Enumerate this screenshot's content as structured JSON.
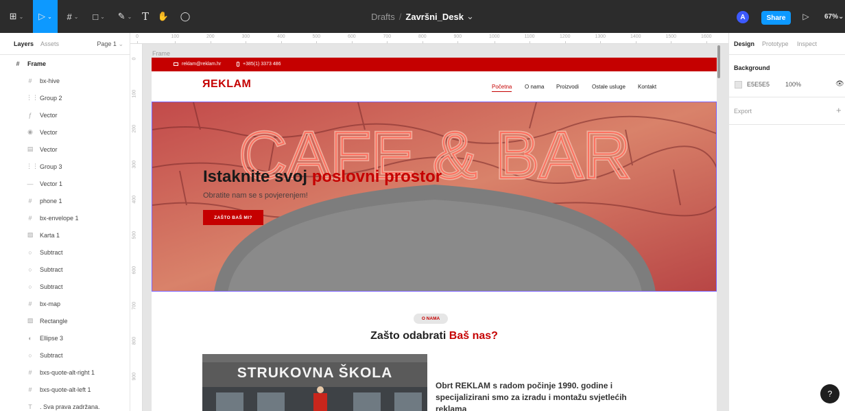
{
  "toolbar": {
    "main_menu_icon": "figma-menu-icon",
    "tools": [
      {
        "name": "move-tool",
        "glyph": "▷"
      },
      {
        "name": "frame-tool",
        "glyph": "#"
      },
      {
        "name": "shape-tool",
        "glyph": "□"
      },
      {
        "name": "pen-tool",
        "glyph": "✎"
      },
      {
        "name": "text-tool",
        "glyph": "T"
      },
      {
        "name": "hand-tool",
        "glyph": "✋"
      },
      {
        "name": "comment-tool",
        "glyph": "◯"
      }
    ],
    "breadcrumb_drafts": "Drafts",
    "breadcrumb_sep": "/",
    "file_name": "Završni_Desk",
    "avatar_initial": "A",
    "share_label": "Share",
    "zoom_label": "67%",
    "accent_color": "#0d99ff"
  },
  "left_panel": {
    "tabs": [
      "Layers",
      "Assets"
    ],
    "page_selector": "Page 1",
    "layers": [
      {
        "icon": "#",
        "label": "Frame",
        "top": true
      },
      {
        "icon": "#",
        "label": "bx-hive"
      },
      {
        "icon": "⋮⋮",
        "label": "Group 2"
      },
      {
        "icon": "ƒ",
        "label": "Vector"
      },
      {
        "icon": "◉",
        "label": "Vector"
      },
      {
        "icon": "▤",
        "label": "Vector"
      },
      {
        "icon": "⋮⋮",
        "label": "Group 3"
      },
      {
        "icon": "—",
        "label": "Vector 1"
      },
      {
        "icon": "#",
        "label": "phone 1"
      },
      {
        "icon": "#",
        "label": "bx-envelope 1"
      },
      {
        "icon": "▨",
        "label": "Karta 1"
      },
      {
        "icon": "○",
        "label": "Subtract"
      },
      {
        "icon": "○",
        "label": "Subtract"
      },
      {
        "icon": "○",
        "label": "Subtract"
      },
      {
        "icon": "#",
        "label": "bx-map"
      },
      {
        "icon": "▨",
        "label": "Rectangle"
      },
      {
        "icon": "◐",
        "label": "Ellipse 3"
      },
      {
        "icon": "○",
        "label": "Subtract"
      },
      {
        "icon": "#",
        "label": "bxs-quote-alt-right 1"
      },
      {
        "icon": "#",
        "label": "bxs-quote-alt-left 1"
      },
      {
        "icon": "T",
        "label": ". Sva prava zadržana."
      }
    ]
  },
  "rulers": {
    "top": [
      "0",
      "100",
      "200",
      "300",
      "400",
      "500",
      "600",
      "700",
      "800",
      "900",
      "1000",
      "1100",
      "1200",
      "1300",
      "1400",
      "1500",
      "1600"
    ],
    "left": [
      "0",
      "100",
      "200",
      "300",
      "400",
      "500",
      "600",
      "700",
      "800",
      "900"
    ]
  },
  "canvas": {
    "frame_label": "Frame",
    "design": {
      "email": "reklam@reklam.hr",
      "phone": "+385(1) 3373 486",
      "logo": "ЯEKLAM",
      "nav": [
        "Početna",
        "O nama",
        "Proizvodi",
        "Ostale usluge",
        "Kontakt"
      ],
      "hero_title_a": "Istaknite svoj ",
      "hero_title_b": "poslovni prostor",
      "hero_sign": "CAFE & BAR",
      "hero_sub": "Obratite nam se s povjerenjem!",
      "hero_button": "ZAŠTO BAŠ MI?",
      "badge": "O NAMA",
      "why_a": "Zašto odabrati ",
      "why_b": "Baš nas?",
      "school_sign": "STRUKOVNA ŠKOLA",
      "about_text": "Obrt REKLAM s radom počinje 1990. godine i specijalizirani smo za izradu i montažu svjetlećih reklama",
      "brand_red": "#c50000"
    }
  },
  "right_panel": {
    "tabs": [
      "Design",
      "Prototype",
      "Inspect"
    ],
    "background_title": "Background",
    "bg_hex": "E5E5E5",
    "bg_opacity": "100%",
    "export_label": "Export",
    "export_add": "+"
  },
  "help_label": "?"
}
